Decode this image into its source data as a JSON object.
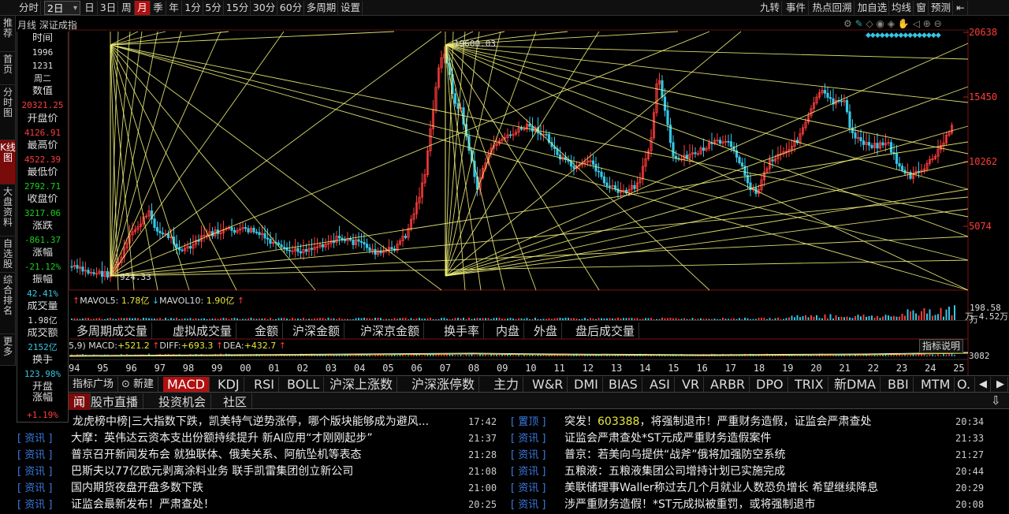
{
  "toolbar": {
    "period_tabs": [
      "分时",
      "2日",
      "日",
      "3日",
      "月",
      "季",
      "年",
      "1分",
      "5分",
      "15分",
      "30分",
      "60分",
      "多周期",
      "设置"
    ],
    "active_period": "月",
    "right_buttons": [
      "九转",
      "事件",
      "热点回溯",
      "加自选",
      "均线",
      "窗",
      "预测"
    ]
  },
  "leftnav": [
    "推荐",
    "首页",
    "分时图",
    "K线图",
    "大盘资料",
    "自选股",
    "综合排名",
    "更多"
  ],
  "leftnav_active": "K线图",
  "chart": {
    "title": "月线  深证成指",
    "high_label": "19600.03",
    "low_label": "924.33",
    "price_ticks": [
      "20638",
      "15450",
      "10262",
      "5074"
    ]
  },
  "datawin": [
    {
      "label": "时间",
      "value": "1996",
      "color": "white"
    },
    {
      "label": "",
      "value": "1231",
      "color": "white"
    },
    {
      "label": "",
      "value": "周二",
      "color": "white"
    },
    {
      "label": "数值",
      "value": "20321.25",
      "color": "red"
    },
    {
      "label": "开盘价",
      "value": "4126.91",
      "color": "red"
    },
    {
      "label": "最高价",
      "value": "4522.39",
      "color": "red"
    },
    {
      "label": "最低价",
      "value": "2792.71",
      "color": "green"
    },
    {
      "label": "收盘价",
      "value": "3217.06",
      "color": "green"
    },
    {
      "label": "涨跌",
      "value": "-861.37",
      "color": "green"
    },
    {
      "label": "涨幅",
      "value": "-21.12%",
      "color": "green"
    },
    {
      "label": "振幅",
      "value": "42.41%",
      "color": "cyan"
    },
    {
      "label": "成交量",
      "value": "1.98亿",
      "color": "white"
    },
    {
      "label": "成交额",
      "value": "2152亿",
      "color": "cyan"
    },
    {
      "label": "换手",
      "value": "123.98%",
      "color": "cyan"
    },
    {
      "label": "开盘涨幅",
      "value": "+1.19%",
      "color": "red"
    }
  ],
  "volume": {
    "mavol5_label": "MAVOL5:",
    "mavol5": "1.78亿",
    "mavol10_label": "MAVOL10:",
    "mavol10": "1.90亿",
    "ticks": [
      "198.58万",
      "万 4.52万"
    ]
  },
  "volume_tabs": [
    "多周期成交量",
    "虚拟成交量",
    "金额",
    "沪深金额",
    "沪深京金额",
    "换手率",
    "内盘",
    "外盘",
    "盘后成交量"
  ],
  "macd": {
    "params": "5,9)",
    "macd_label": "MACD:",
    "macd": "+521.2",
    "diff_label": "DIFF:",
    "diff": "+693.3",
    "dea_label": "DEA:",
    "dea": "+432.7",
    "tick": "3082",
    "indicator_btn": "指标说明"
  },
  "years": [
    "94",
    "95",
    "96",
    "97",
    "98",
    "99",
    "00",
    "01",
    "02",
    "03",
    "04",
    "05",
    "06",
    "07",
    "08",
    "09",
    "10",
    "11",
    "12",
    "13",
    "14",
    "15",
    "16",
    "17",
    "18",
    "19",
    "20",
    "21",
    "22",
    "23",
    "24",
    "25"
  ],
  "indicator_tabs": [
    "指标广场",
    "新建",
    "MACD",
    "KDJ",
    "RSI",
    "BOLL",
    "沪深上涨数",
    "沪深涨停数",
    "主力",
    "W&R",
    "DMI",
    "BIAS",
    "ASI",
    "VR",
    "ARBR",
    "DPO",
    "TRIX",
    "新DMA",
    "BBI",
    "MTM",
    "O."
  ],
  "indicator_active": "MACD",
  "news_tabs": [
    "闻",
    "股市直播",
    "投资机会",
    "社区"
  ],
  "news_left": [
    {
      "tag": "",
      "title": "龙虎榜中榜|三大指数下跌，凯美特气逆势涨停，哪个版块能够成为避风...",
      "time": "17:42"
    },
    {
      "tag": "[  资讯  ]",
      "title": "大摩：英伟达云资本支出份额持续提升 新AI应用“才刚刚起步”",
      "time": "21:37"
    },
    {
      "tag": "[  资讯  ]",
      "title": "普京召开新闻发布会 就独联体、俄美关系、阿航坠机等表态",
      "time": "21:28"
    },
    {
      "tag": "[  资讯  ]",
      "title": "巴斯夫以77亿欧元剥离涂料业务 联手凯雷集团创立新公司",
      "time": "21:08"
    },
    {
      "tag": "[  资讯  ]",
      "title": "国内期货夜盘开盘多数下跌",
      "time": "21:00"
    },
    {
      "tag": "[  资讯  ]",
      "title": "证监会最新发布！严肃查处！",
      "time": "20:25"
    }
  ],
  "news_right": [
    {
      "tag": "[  置顶  ]",
      "pre": "突发！",
      "code": "603388",
      "title": "，将强制退市！严重财务造假，证监会严肃查处",
      "time": "20:34"
    },
    {
      "tag": "[  资讯  ]",
      "pre": "",
      "code": "",
      "title": "证监会严肃查处*ST元成严重财务造假案件",
      "time": "21:33"
    },
    {
      "tag": "[  资讯  ]",
      "pre": "",
      "code": "",
      "title": "普京：若美向乌提供“战斧”俄将加强防空系统",
      "time": "21:27"
    },
    {
      "tag": "[  资讯  ]",
      "pre": "",
      "code": "",
      "title": "五粮液：五粮液集团公司增持计划已实施完成",
      "time": "20:44"
    },
    {
      "tag": "[  资讯  ]",
      "pre": "",
      "code": "",
      "title": "美联储理事Waller称过去几个月就业人数恐负增长 希望继续降息",
      "time": "20:29"
    },
    {
      "tag": "[  资讯  ]",
      "pre": "",
      "code": "",
      "title": "涉严重财务造假！*ST元成拟被重罚，或将强制退市",
      "time": "20:08"
    }
  ],
  "colors": {
    "up": "#ff3c3c",
    "down": "#35c6e5",
    "gann": "#f2f27a",
    "accent": "#b01010"
  }
}
